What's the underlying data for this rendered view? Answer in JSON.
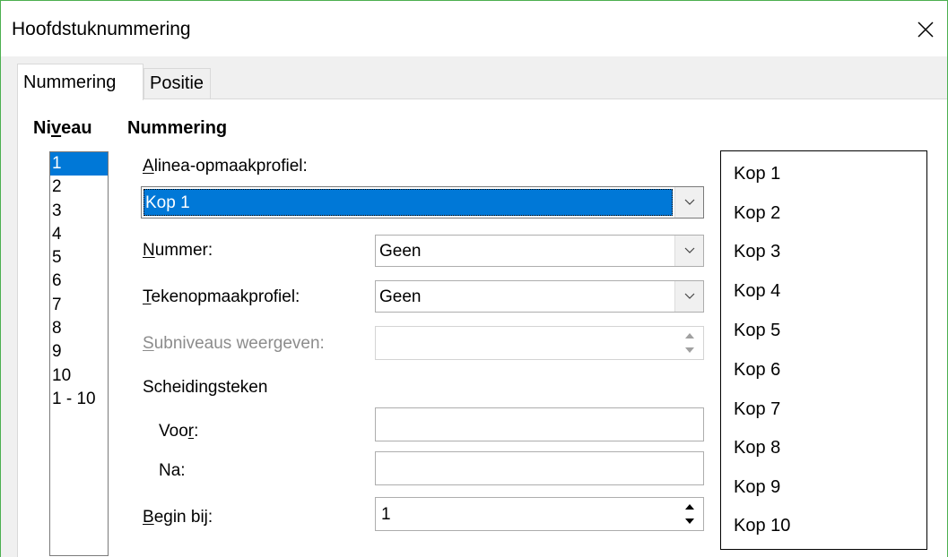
{
  "window": {
    "title": "Hoofdstuknummering"
  },
  "tabs": [
    {
      "label": "Nummering",
      "active": true
    },
    {
      "label": "Positie",
      "active": false
    }
  ],
  "level": {
    "heading_pre": "Ni",
    "heading_ul": "v",
    "heading_post": "eau",
    "items": [
      "1",
      "2",
      "3",
      "4",
      "5",
      "6",
      "7",
      "8",
      "9",
      "10",
      "1 - 10"
    ],
    "selected": "1"
  },
  "numbering": {
    "heading": "Nummering",
    "paragraph_style": {
      "label_ul": "A",
      "label_rest": "linea-opmaakprofiel:",
      "value": "Kop 1"
    },
    "number": {
      "label_ul": "N",
      "label_rest": "ummer:",
      "value": "Geen"
    },
    "char_style": {
      "label_ul": "T",
      "label_rest": "ekenopmaakprofiel:",
      "value": "Geen"
    },
    "sublevels": {
      "label_ul": "S",
      "label_rest": "ubniveaus weergeven:",
      "value": ""
    },
    "separator": {
      "heading": "Scheidingsteken",
      "before_label_pre": "Voo",
      "before_label_ul": "r",
      "before_label_post": ":",
      "before_value": "",
      "after_label": "Na:",
      "after_value": ""
    },
    "start_at": {
      "label_ul": "B",
      "label_rest": "egin bij:",
      "value": "1"
    }
  },
  "preview": {
    "items": [
      "Kop 1",
      "Kop 2",
      "Kop 3",
      "Kop 4",
      "Kop 5",
      "Kop 6",
      "Kop 7",
      "Kop 8",
      "Kop 9",
      "Kop 10"
    ]
  },
  "colors": {
    "selection": "#0078d7",
    "window_border": "#4caf50"
  },
  "icons": {
    "close": "close-icon",
    "dropdown": "chevron-down-icon",
    "spin_up": "spin-up-icon",
    "spin_down": "spin-down-icon"
  }
}
